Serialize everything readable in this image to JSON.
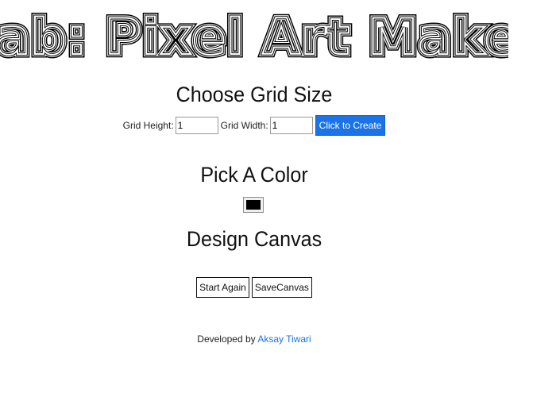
{
  "header": {
    "title": "Lab: Pixel Art Maker"
  },
  "grid_section": {
    "heading": "Choose Grid Size",
    "height_label": "Grid Height:",
    "height_value": "1",
    "width_label": "Grid Width:",
    "width_value": "1",
    "submit_label": "Click to Create"
  },
  "color_section": {
    "heading": "Pick A Color",
    "selected_color": "#000000"
  },
  "canvas_section": {
    "heading": "Design Canvas",
    "start_again_label": "Start Again",
    "save_canvas_label": "SaveCanvas"
  },
  "footer": {
    "prefix": "Developed by",
    "author_link": "Aksay Tiwari"
  },
  "colors": {
    "accent": "#1a73e8",
    "text": "#111111",
    "background": "#ffffff"
  }
}
